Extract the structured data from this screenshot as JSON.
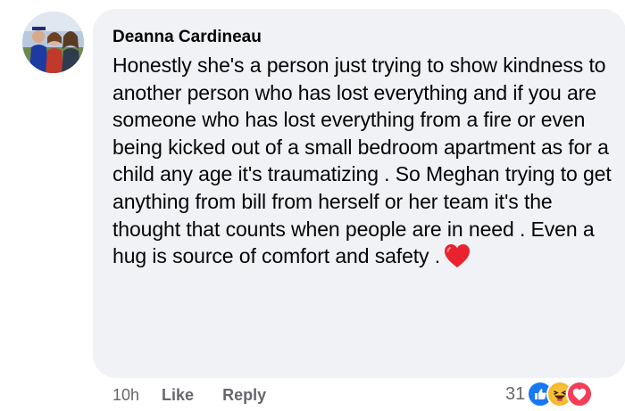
{
  "comment": {
    "author": "Deanna Cardineau",
    "text": "Honestly she's a person just trying to show kindness to another person who has lost everything and if you are someone who has lost everything from a fire or even being kicked out of a small bedroom apartment as for a child any age it's traumatizing . So Meghan trying to get anything from bill from herself or her team it's the thought that counts when people are in need . Even a hug is source of comfort and safety .",
    "emoji": "red-heart-icon"
  },
  "actions": {
    "timestamp": "10h",
    "like_label": "Like",
    "reply_label": "Reply"
  },
  "reactions": {
    "count": "31",
    "icons": [
      "like-reaction-icon",
      "haha-reaction-icon",
      "love-reaction-icon"
    ]
  },
  "colors": {
    "bubble": "#f0f2f5",
    "text": "#050505",
    "secondary_text": "#65676b",
    "like_blue": "#1877f2",
    "love_red": "#f33e58",
    "haha_yellow": "#f7b928"
  }
}
